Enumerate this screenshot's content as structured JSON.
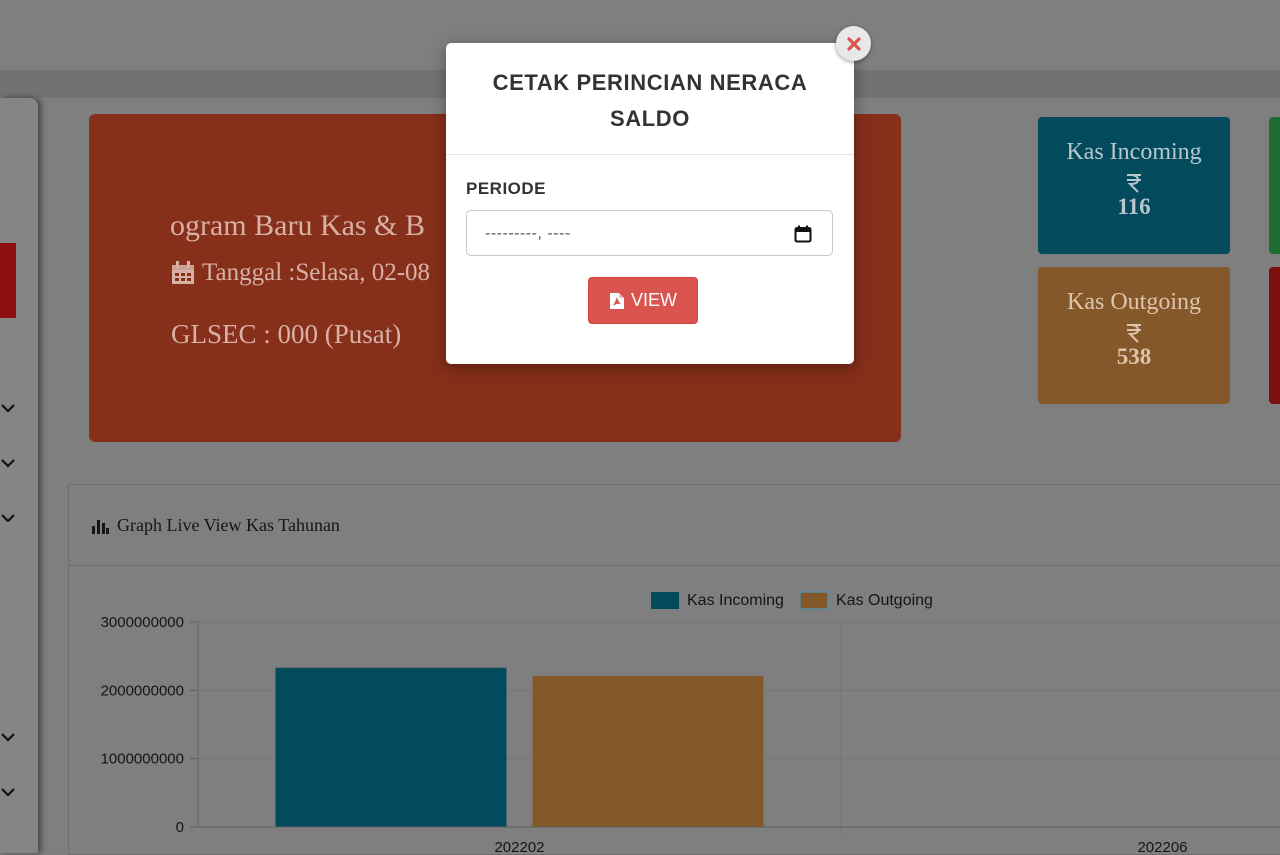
{
  "welcome": {
    "title": "ogram Baru Kas & B",
    "date_text": "Tanggal :Selasa, 02-08",
    "glsec": "GLSEC : 000 (Pusat)"
  },
  "stats": {
    "incoming": {
      "label": "Kas Incoming",
      "value": "116",
      "icon": "rupiah-icon"
    },
    "outgoing": {
      "label": "Kas Outgoing",
      "value": "538",
      "icon": "rupiah-icon"
    }
  },
  "graph_panel": {
    "title": "Graph Live View Kas Tahunan",
    "icon": "bar-chart-icon"
  },
  "chart_data": {
    "type": "bar",
    "categories": [
      "202202",
      "202206"
    ],
    "series": [
      {
        "name": "Kas Incoming",
        "values": [
          2330000000,
          null
        ],
        "color": "#034b5c"
      },
      {
        "name": "Kas Outgoing",
        "values": [
          2210000000,
          null
        ],
        "color": "#85582a"
      }
    ],
    "yticks": [
      "0",
      "1000000000",
      "2000000000",
      "3000000000"
    ],
    "ylim": [
      0,
      3000000000
    ],
    "legend": "top-center",
    "grid": true
  },
  "modal": {
    "title_line1": "CETAK PERINCIAN NERACA",
    "title_line2": "SALDO",
    "field_label": "PERIODE",
    "date_placeholder": "---------, ----",
    "view_label": "VIEW",
    "close_icon": "close-icon",
    "colors": {
      "view": "#d9534f",
      "close": "#d9534f"
    }
  }
}
